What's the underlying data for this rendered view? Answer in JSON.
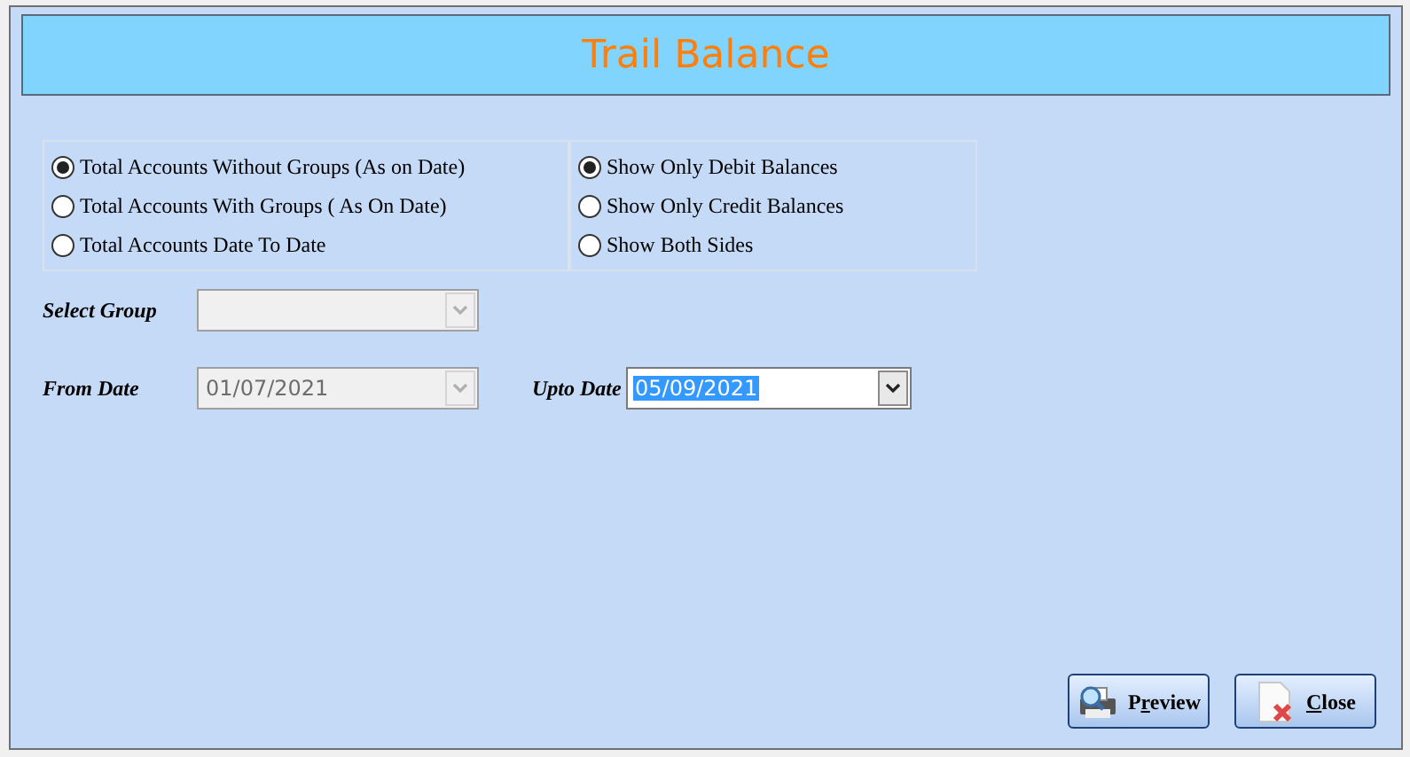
{
  "title": "Trail Balance",
  "account_options": [
    {
      "label": "Total Accounts Without Groups (As on Date)",
      "selected": true
    },
    {
      "label": "Total Accounts With Groups ( As On Date)",
      "selected": false
    },
    {
      "label": "Total Accounts Date To Date",
      "selected": false
    }
  ],
  "balance_options": [
    {
      "label": "Show Only Debit Balances",
      "selected": true
    },
    {
      "label": "Show Only Credit Balances",
      "selected": false
    },
    {
      "label": "Show Both Sides",
      "selected": false
    }
  ],
  "select_group": {
    "label": "Select Group",
    "disabled": true
  },
  "from_date": {
    "label": "From Date",
    "value": "01/07/2021",
    "disabled": true
  },
  "upto_date": {
    "label": "Upto Date",
    "value": "05/09/2021",
    "disabled": false,
    "text_selected": true
  },
  "buttons": [
    {
      "kind": "preview",
      "label_start": "P",
      "access_key": "r",
      "label_end": "eview"
    },
    {
      "kind": "close",
      "access_key": "C",
      "label_end": "lose"
    }
  ]
}
